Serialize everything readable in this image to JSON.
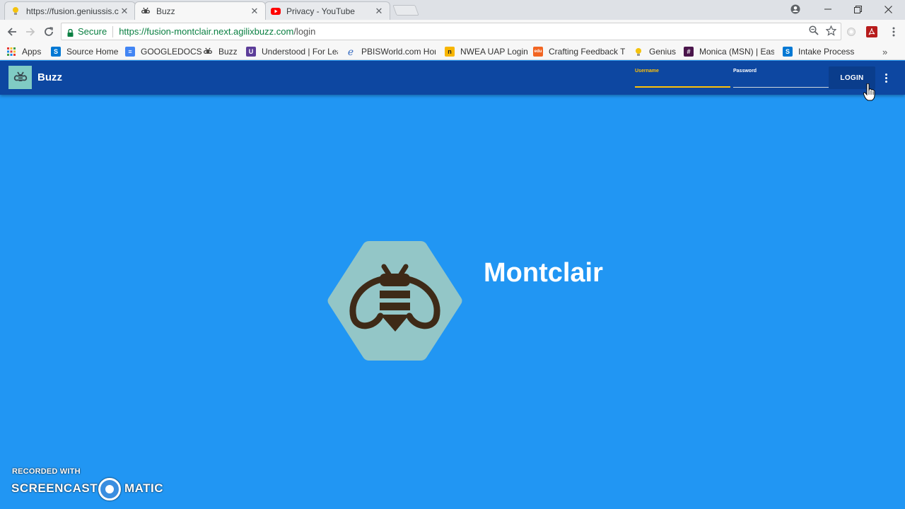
{
  "browser": {
    "tabs": [
      {
        "title": "https://fusion.geniussis.c",
        "favicon": "lightbulb-icon"
      },
      {
        "title": "Buzz",
        "favicon": "bee-icon"
      },
      {
        "title": "Privacy - YouTube",
        "favicon": "youtube-icon"
      }
    ],
    "active_tab": 1,
    "security_label": "Secure",
    "url_host": "https://fusion-montclair.next.agilixbuzz.com",
    "url_path": "/login"
  },
  "bookmarks": [
    {
      "label": "Apps",
      "icon": "apps-grid-icon"
    },
    {
      "label": "Source Home",
      "icon": "sharepoint-icon"
    },
    {
      "label": "GOOGLEDOCS",
      "icon": "docs-icon"
    },
    {
      "label": "Buzz",
      "icon": "bee-icon"
    },
    {
      "label": "Understood | For Lea",
      "icon": "understood-icon"
    },
    {
      "label": "PBISWorld.com Hom",
      "icon": "pbis-icon"
    },
    {
      "label": "NWEA UAP Login",
      "icon": "nwea-icon"
    },
    {
      "label": "Crafting Feedback T",
      "icon": "edu-icon"
    },
    {
      "label": "Genius",
      "icon": "lightbulb-icon"
    },
    {
      "label": "Monica (MSN) | East",
      "icon": "slack-icon"
    },
    {
      "label": "Intake Process",
      "icon": "sharepoint-icon"
    }
  ],
  "app": {
    "title": "Buzz",
    "username_label": "Username",
    "password_label": "Password",
    "username_value": "",
    "password_value": "",
    "login_label": "LOGIN",
    "colors": {
      "header": "#0d47a1",
      "background": "#2196f3",
      "focus": "#ffc107",
      "logo": "#80cbc4"
    }
  },
  "hero": {
    "school_name": "Montclair"
  },
  "watermark": {
    "line1": "RECORDED WITH",
    "left": "SCREENCAST",
    "right": "MATIC"
  }
}
